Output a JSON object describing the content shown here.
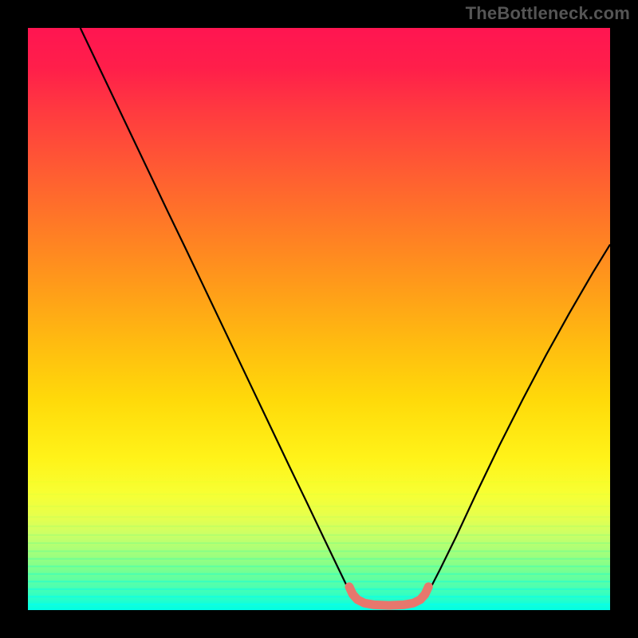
{
  "watermark": "TheBottleneck.com",
  "stripes": [
    {
      "y": 0.78,
      "color": "#f0ff2a"
    },
    {
      "y": 0.801,
      "color": "#eaff38"
    },
    {
      "y": 0.822,
      "color": "#dcff47"
    },
    {
      "y": 0.84,
      "color": "#ccff56"
    },
    {
      "y": 0.856,
      "color": "#b8ff64"
    },
    {
      "y": 0.871,
      "color": "#a1ff73"
    },
    {
      "y": 0.885,
      "color": "#89ff82"
    },
    {
      "y": 0.899,
      "color": "#70ff92"
    },
    {
      "y": 0.912,
      "color": "#58ffa3"
    },
    {
      "y": 0.925,
      "color": "#41ffb4"
    },
    {
      "y": 0.938,
      "color": "#2bffc5"
    },
    {
      "y": 0.951,
      "color": "#19ffd5"
    },
    {
      "y": 0.964,
      "color": "#0cffe3"
    },
    {
      "y": 0.977,
      "color": "#05ffee"
    },
    {
      "y": 0.99,
      "color": "#01fff6"
    }
  ],
  "chart_data": {
    "type": "line",
    "title": "",
    "xlabel": "",
    "ylabel": "",
    "xlim": [
      0,
      1
    ],
    "ylim": [
      0,
      1
    ],
    "grid": false,
    "legend": false,
    "series": [
      {
        "name": "bottleneck-curve",
        "color": "#000000",
        "width": 2.2,
        "points": [
          [
            0.09,
            1.0
          ],
          [
            0.12,
            0.937
          ],
          [
            0.15,
            0.874
          ],
          [
            0.18,
            0.811
          ],
          [
            0.21,
            0.748
          ],
          [
            0.24,
            0.685
          ],
          [
            0.27,
            0.623
          ],
          [
            0.3,
            0.56
          ],
          [
            0.33,
            0.497
          ],
          [
            0.36,
            0.434
          ],
          [
            0.39,
            0.371
          ],
          [
            0.42,
            0.308
          ],
          [
            0.45,
            0.245
          ],
          [
            0.48,
            0.183
          ],
          [
            0.51,
            0.12
          ],
          [
            0.535,
            0.068
          ],
          [
            0.55,
            0.037
          ],
          [
            0.558,
            0.022
          ],
          [
            0.566,
            0.015
          ],
          [
            0.58,
            0.011
          ],
          [
            0.6,
            0.009
          ],
          [
            0.63,
            0.009
          ],
          [
            0.66,
            0.011
          ],
          [
            0.674,
            0.015
          ],
          [
            0.682,
            0.022
          ],
          [
            0.69,
            0.035
          ],
          [
            0.708,
            0.07
          ],
          [
            0.735,
            0.125
          ],
          [
            0.77,
            0.2
          ],
          [
            0.81,
            0.283
          ],
          [
            0.85,
            0.362
          ],
          [
            0.89,
            0.438
          ],
          [
            0.93,
            0.51
          ],
          [
            0.97,
            0.579
          ],
          [
            1.0,
            0.628
          ]
        ]
      },
      {
        "name": "highlight-arc",
        "color": "#e7776d",
        "width": 11,
        "linecap": "round",
        "points": [
          [
            0.552,
            0.04
          ],
          [
            0.558,
            0.027
          ],
          [
            0.566,
            0.018
          ],
          [
            0.578,
            0.012
          ],
          [
            0.595,
            0.009
          ],
          [
            0.62,
            0.008
          ],
          [
            0.645,
            0.009
          ],
          [
            0.662,
            0.012
          ],
          [
            0.674,
            0.018
          ],
          [
            0.682,
            0.027
          ],
          [
            0.688,
            0.04
          ]
        ]
      }
    ]
  }
}
